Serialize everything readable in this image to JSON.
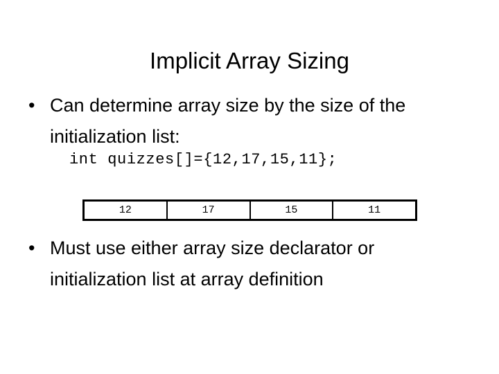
{
  "slide": {
    "title": "Implicit Array Sizing",
    "background_color": "#ffffff",
    "text_color": "#000000"
  },
  "bullets": [
    {
      "marker": "•",
      "line1": "Can determine array size by the size of the",
      "line2": "initialization list:"
    },
    {
      "marker": "•",
      "line1": "Must use either array size declarator or",
      "line2": "initialization list at array definition"
    }
  ],
  "code": {
    "text": "int quizzes[]={12,17,15,11};"
  },
  "array_table": {
    "cells": [
      {
        "value": "12"
      },
      {
        "value": "17"
      },
      {
        "value": "15"
      },
      {
        "value": "11"
      }
    ]
  }
}
